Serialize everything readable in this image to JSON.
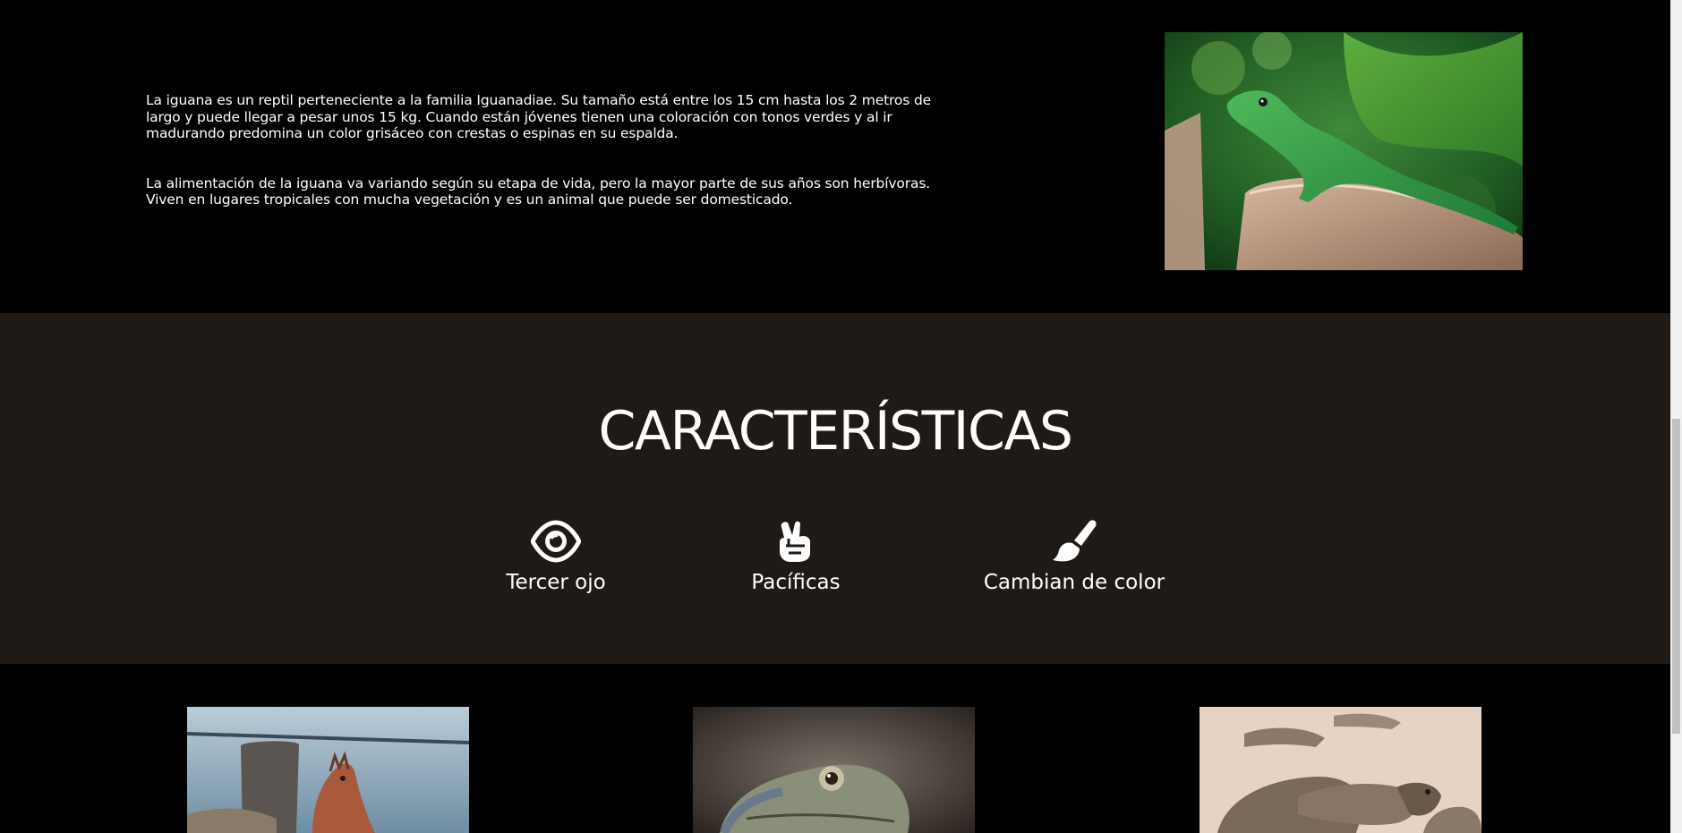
{
  "intro": {
    "paragraph_1": "La iguana es un reptil perteneciente a la familia Iguanadiae. Su tamaño está entre los 15 cm hasta los 2 metros de largo y puede llegar a pesar unos 15 kg. Cuando están jóvenes tienen una coloración con tonos verdes y al ir madurando predomina un color grisáceo con crestas o espinas en su espalda.",
    "paragraph_2": "La alimentación de la iguana va variando según su etapa de vida, pero la mayor parte de sus años son herbívoras. Viven en lugares tropicales con mucha vegetación y es un animal que puede ser domesticado.",
    "photo_icon": "green-iguana-photo"
  },
  "features": {
    "title": "CARACTERÍSTICAS",
    "items": [
      {
        "label": "Tercer ojo",
        "icon": "eye-icon"
      },
      {
        "label": "Pacíficas",
        "icon": "peace-hand-icon"
      },
      {
        "label": "Cambian de color",
        "icon": "paint-brush-icon"
      }
    ]
  },
  "gallery": {
    "items": [
      {
        "icon": "iguana-by-water-photo"
      },
      {
        "icon": "iguana-closeup-photo"
      },
      {
        "icon": "iguanas-on-sand-photo"
      }
    ]
  },
  "colors": {
    "intro_bg": "#000000",
    "features_bg": "#1f1a16",
    "text": "#ffffff"
  }
}
